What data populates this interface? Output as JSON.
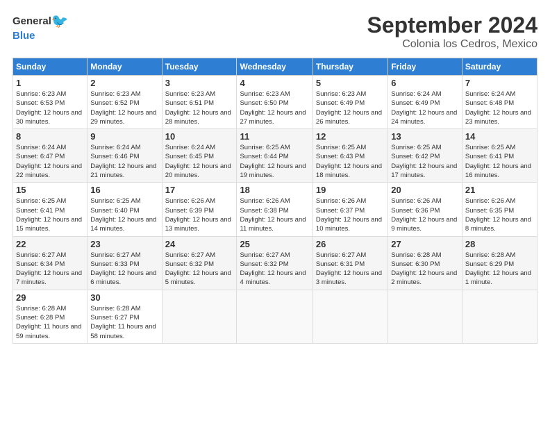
{
  "header": {
    "logo_general": "General",
    "logo_blue": "Blue",
    "title": "September 2024",
    "location": "Colonia los Cedros, Mexico"
  },
  "weekdays": [
    "Sunday",
    "Monday",
    "Tuesday",
    "Wednesday",
    "Thursday",
    "Friday",
    "Saturday"
  ],
  "weeks": [
    [
      {
        "day": "1",
        "sunrise": "6:23 AM",
        "sunset": "6:53 PM",
        "daylight": "12 hours and 30 minutes."
      },
      {
        "day": "2",
        "sunrise": "6:23 AM",
        "sunset": "6:52 PM",
        "daylight": "12 hours and 29 minutes."
      },
      {
        "day": "3",
        "sunrise": "6:23 AM",
        "sunset": "6:51 PM",
        "daylight": "12 hours and 28 minutes."
      },
      {
        "day": "4",
        "sunrise": "6:23 AM",
        "sunset": "6:50 PM",
        "daylight": "12 hours and 27 minutes."
      },
      {
        "day": "5",
        "sunrise": "6:23 AM",
        "sunset": "6:49 PM",
        "daylight": "12 hours and 26 minutes."
      },
      {
        "day": "6",
        "sunrise": "6:24 AM",
        "sunset": "6:49 PM",
        "daylight": "12 hours and 24 minutes."
      },
      {
        "day": "7",
        "sunrise": "6:24 AM",
        "sunset": "6:48 PM",
        "daylight": "12 hours and 23 minutes."
      }
    ],
    [
      {
        "day": "8",
        "sunrise": "6:24 AM",
        "sunset": "6:47 PM",
        "daylight": "12 hours and 22 minutes."
      },
      {
        "day": "9",
        "sunrise": "6:24 AM",
        "sunset": "6:46 PM",
        "daylight": "12 hours and 21 minutes."
      },
      {
        "day": "10",
        "sunrise": "6:24 AM",
        "sunset": "6:45 PM",
        "daylight": "12 hours and 20 minutes."
      },
      {
        "day": "11",
        "sunrise": "6:25 AM",
        "sunset": "6:44 PM",
        "daylight": "12 hours and 19 minutes."
      },
      {
        "day": "12",
        "sunrise": "6:25 AM",
        "sunset": "6:43 PM",
        "daylight": "12 hours and 18 minutes."
      },
      {
        "day": "13",
        "sunrise": "6:25 AM",
        "sunset": "6:42 PM",
        "daylight": "12 hours and 17 minutes."
      },
      {
        "day": "14",
        "sunrise": "6:25 AM",
        "sunset": "6:41 PM",
        "daylight": "12 hours and 16 minutes."
      }
    ],
    [
      {
        "day": "15",
        "sunrise": "6:25 AM",
        "sunset": "6:41 PM",
        "daylight": "12 hours and 15 minutes."
      },
      {
        "day": "16",
        "sunrise": "6:25 AM",
        "sunset": "6:40 PM",
        "daylight": "12 hours and 14 minutes."
      },
      {
        "day": "17",
        "sunrise": "6:26 AM",
        "sunset": "6:39 PM",
        "daylight": "12 hours and 13 minutes."
      },
      {
        "day": "18",
        "sunrise": "6:26 AM",
        "sunset": "6:38 PM",
        "daylight": "12 hours and 11 minutes."
      },
      {
        "day": "19",
        "sunrise": "6:26 AM",
        "sunset": "6:37 PM",
        "daylight": "12 hours and 10 minutes."
      },
      {
        "day": "20",
        "sunrise": "6:26 AM",
        "sunset": "6:36 PM",
        "daylight": "12 hours and 9 minutes."
      },
      {
        "day": "21",
        "sunrise": "6:26 AM",
        "sunset": "6:35 PM",
        "daylight": "12 hours and 8 minutes."
      }
    ],
    [
      {
        "day": "22",
        "sunrise": "6:27 AM",
        "sunset": "6:34 PM",
        "daylight": "12 hours and 7 minutes."
      },
      {
        "day": "23",
        "sunrise": "6:27 AM",
        "sunset": "6:33 PM",
        "daylight": "12 hours and 6 minutes."
      },
      {
        "day": "24",
        "sunrise": "6:27 AM",
        "sunset": "6:32 PM",
        "daylight": "12 hours and 5 minutes."
      },
      {
        "day": "25",
        "sunrise": "6:27 AM",
        "sunset": "6:32 PM",
        "daylight": "12 hours and 4 minutes."
      },
      {
        "day": "26",
        "sunrise": "6:27 AM",
        "sunset": "6:31 PM",
        "daylight": "12 hours and 3 minutes."
      },
      {
        "day": "27",
        "sunrise": "6:28 AM",
        "sunset": "6:30 PM",
        "daylight": "12 hours and 2 minutes."
      },
      {
        "day": "28",
        "sunrise": "6:28 AM",
        "sunset": "6:29 PM",
        "daylight": "12 hours and 1 minute."
      }
    ],
    [
      {
        "day": "29",
        "sunrise": "6:28 AM",
        "sunset": "6:28 PM",
        "daylight": "11 hours and 59 minutes."
      },
      {
        "day": "30",
        "sunrise": "6:28 AM",
        "sunset": "6:27 PM",
        "daylight": "11 hours and 58 minutes."
      },
      null,
      null,
      null,
      null,
      null
    ]
  ],
  "labels": {
    "sunrise": "Sunrise: ",
    "sunset": "Sunset: ",
    "daylight": "Daylight: "
  }
}
